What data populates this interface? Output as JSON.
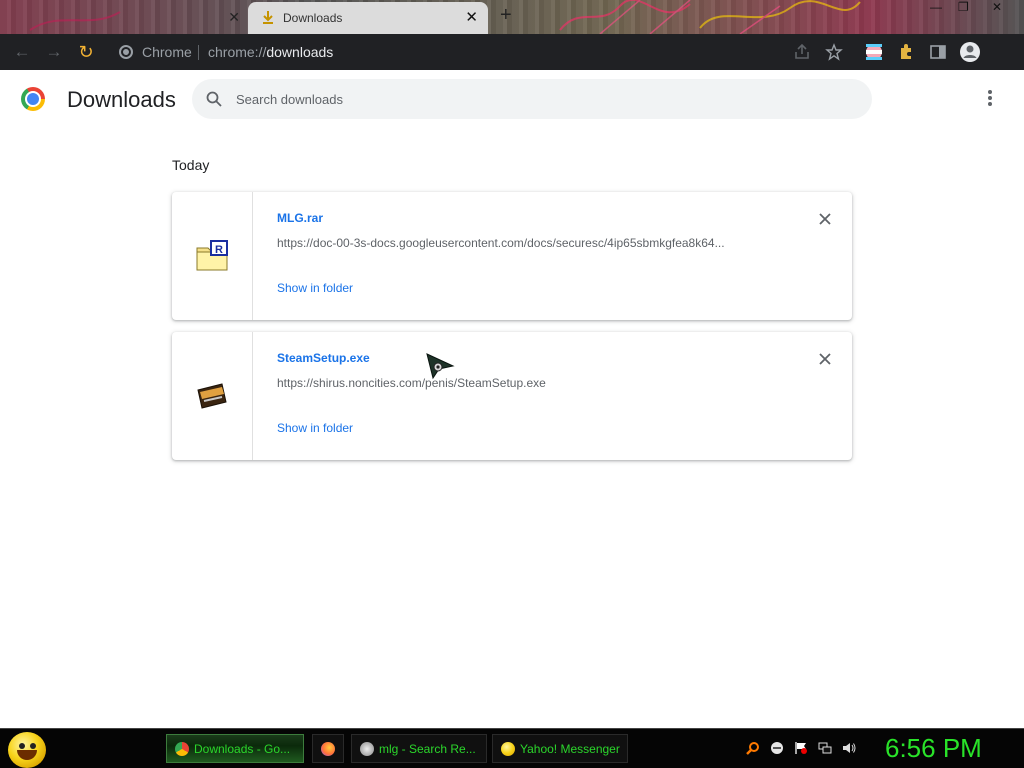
{
  "window": {
    "tab_title": "Downloads",
    "new_tab_symbol": "+",
    "close_symbol": "✕"
  },
  "toolbar": {
    "omnibox_label": "Chrome",
    "url_prefix": "chrome://",
    "url_host": "downloads"
  },
  "page": {
    "title": "Downloads",
    "search_placeholder": "Search downloads",
    "section_label": "Today"
  },
  "downloads": [
    {
      "name": "MLG.rar",
      "url": "https://doc-00-3s-docs.googleusercontent.com/docs/securesc/4ip65sbmkgfea8k64...",
      "action": "Show in folder",
      "icon": "rar-archive-icon"
    },
    {
      "name": "SteamSetup.exe",
      "url": "https://shirus.noncities.com/penis/SteamSetup.exe",
      "action": "Show in folder",
      "icon": "exe-installer-icon"
    }
  ],
  "taskbar": {
    "items": [
      {
        "label": "Downloads - Go...",
        "active": true
      },
      {
        "label": "",
        "active": false
      },
      {
        "label": "mlg - Search Re...",
        "active": false
      },
      {
        "label": "Yahoo! Messenger",
        "active": false
      }
    ],
    "clock": "6:56 PM"
  },
  "colors": {
    "accent": "#1a73e8",
    "toolbar_bg": "#202124",
    "taskbar_text": "#2bd62b",
    "clock": "#29e329"
  }
}
